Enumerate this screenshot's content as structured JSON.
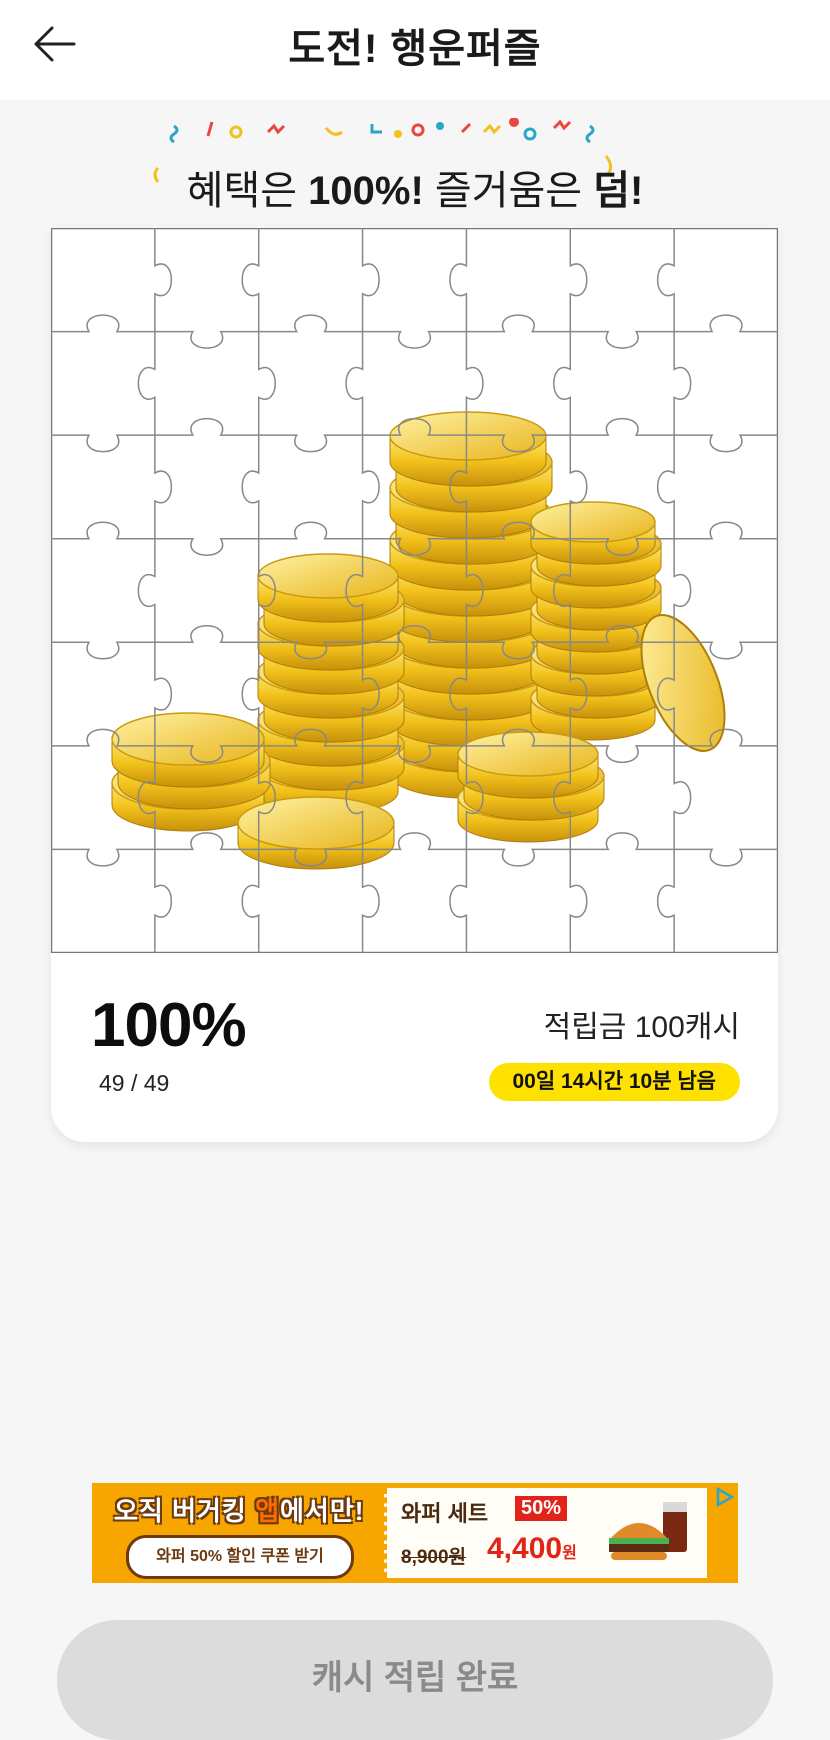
{
  "header": {
    "title": "도전! 행운퍼즐",
    "back_icon": "arrow-left-icon"
  },
  "banner": {
    "pre": "혜택은 ",
    "highlight1": "100%!",
    "mid": " 즐거움은 ",
    "highlight2": "덤!"
  },
  "puzzle": {
    "rows": 7,
    "cols": 7,
    "image": "gold-coins-stack",
    "coin_color": "#f2c21b"
  },
  "progress": {
    "percent_text": "100%",
    "completed_fraction": 1.0,
    "count_text": "49 / 49",
    "reward_text": "적립금 100캐시",
    "time_left_text": "00일 14시간 10분 남음",
    "badge_color": "#ffe100"
  },
  "ad": {
    "headline_a": "오직 버거킹 ",
    "headline_b": "앱",
    "headline_c": "에서만!",
    "coupon_label": "와퍼 50% 할인 쿠폰 받기",
    "set_title": "와퍼 세트",
    "discount": "50%",
    "old_price": "8,900원",
    "new_price": "4,400",
    "won": "원",
    "bg_color": "#f7a600",
    "adchoice_icon": "ad-choices-icon"
  },
  "footer": {
    "complete_label": "캐시 적립 완료"
  }
}
